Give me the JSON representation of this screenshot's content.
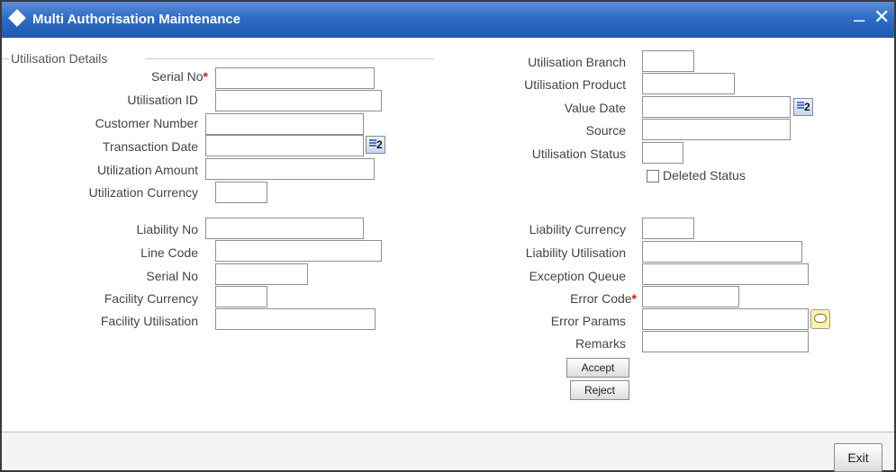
{
  "window": {
    "title": "Multi Authorisation Maintenance",
    "minimize": "–",
    "close": "✕"
  },
  "section": {
    "title": "Utilisation Details"
  },
  "left_top": {
    "serial_no": "Serial No",
    "utilisation_id": "Utilisation ID",
    "customer_number": "Customer Number",
    "transaction_date": "Transaction Date",
    "utilization_amount": "Utilization Amount",
    "utilization_currency": "Utilization Currency"
  },
  "left_bottom": {
    "liability_no": "Liability No",
    "line_code": "Line Code",
    "serial_no": "Serial No",
    "facility_currency": "Facility Currency",
    "facility_utilisation": "Facility Utilisation"
  },
  "right_top": {
    "utilisation_branch": "Utilisation Branch",
    "utilisation_product": "Utilisation Product",
    "value_date": "Value Date",
    "source": "Source",
    "utilisation_status": "Utilisation Status",
    "deleted_status": "Deleted Status"
  },
  "right_bottom": {
    "liability_currency": "Liability Currency",
    "liability_utilisation": "Liability Utilisation",
    "exception_queue": "Exception Queue",
    "error_code": "Error Code",
    "error_params": "Error Params",
    "remarks": "Remarks"
  },
  "required_mark": "*",
  "calendar_num": "2",
  "buttons": {
    "accept": "Accept",
    "reject": "Reject",
    "exit": "Exit"
  },
  "colors": {
    "titlebar": "#2f6cc6",
    "required": "#dd1111"
  },
  "icons": {
    "calendar": "calendar-icon",
    "chat": "chat-bubble-icon"
  }
}
